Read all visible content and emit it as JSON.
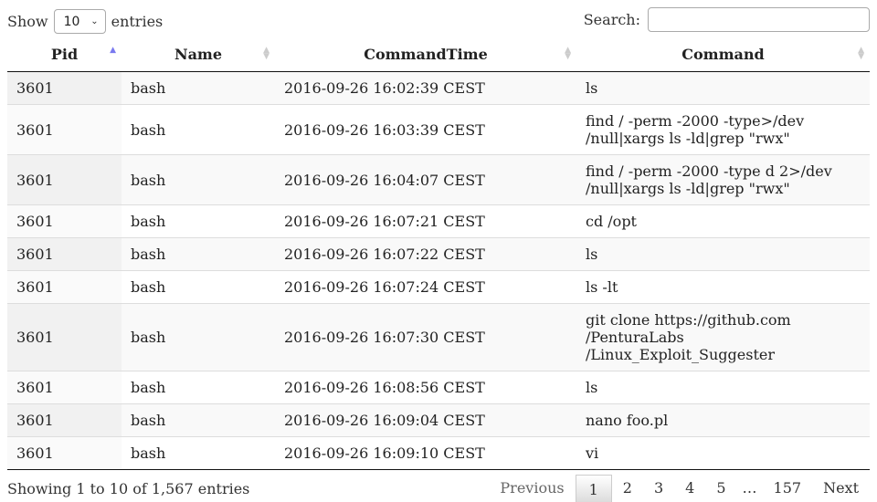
{
  "controls": {
    "show_label": "Show",
    "page_length": "10",
    "entries_label": "entries",
    "search_label": "Search:",
    "search_value": ""
  },
  "columns": [
    "Pid",
    "Name",
    "CommandTime",
    "Command"
  ],
  "rows": [
    {
      "pid": "3601",
      "name": "bash",
      "time": "2016-09-26 16:02:39 CEST",
      "command": "ls"
    },
    {
      "pid": "3601",
      "name": "bash",
      "time": "2016-09-26 16:03:39 CEST",
      "command": "find / -perm -2000 -type>/dev\n/null|xargs ls -ld|grep \"rwx\""
    },
    {
      "pid": "3601",
      "name": "bash",
      "time": "2016-09-26 16:04:07 CEST",
      "command": "find / -perm -2000 -type d 2>/dev\n/null|xargs ls -ld|grep \"rwx\""
    },
    {
      "pid": "3601",
      "name": "bash",
      "time": "2016-09-26 16:07:21 CEST",
      "command": "cd /opt"
    },
    {
      "pid": "3601",
      "name": "bash",
      "time": "2016-09-26 16:07:22 CEST",
      "command": "ls"
    },
    {
      "pid": "3601",
      "name": "bash",
      "time": "2016-09-26 16:07:24 CEST",
      "command": "ls -lt"
    },
    {
      "pid": "3601",
      "name": "bash",
      "time": "2016-09-26 16:07:30 CEST",
      "command": "git clone https://github.com\n/PenturaLabs\n/Linux_Exploit_Suggester"
    },
    {
      "pid": "3601",
      "name": "bash",
      "time": "2016-09-26 16:08:56 CEST",
      "command": "ls"
    },
    {
      "pid": "3601",
      "name": "bash",
      "time": "2016-09-26 16:09:04 CEST",
      "command": "nano foo.pl"
    },
    {
      "pid": "3601",
      "name": "bash",
      "time": "2016-09-26 16:09:10 CEST",
      "command": "vi"
    }
  ],
  "footer": {
    "info": "Showing 1 to 10 of 1,567 entries",
    "previous": "Previous",
    "next": "Next",
    "pages": [
      "1",
      "2",
      "3",
      "4",
      "5"
    ],
    "ellipsis": "…",
    "last_page": "157",
    "current_page": "1"
  },
  "sort": {
    "column": "Pid",
    "direction": "ascending"
  }
}
